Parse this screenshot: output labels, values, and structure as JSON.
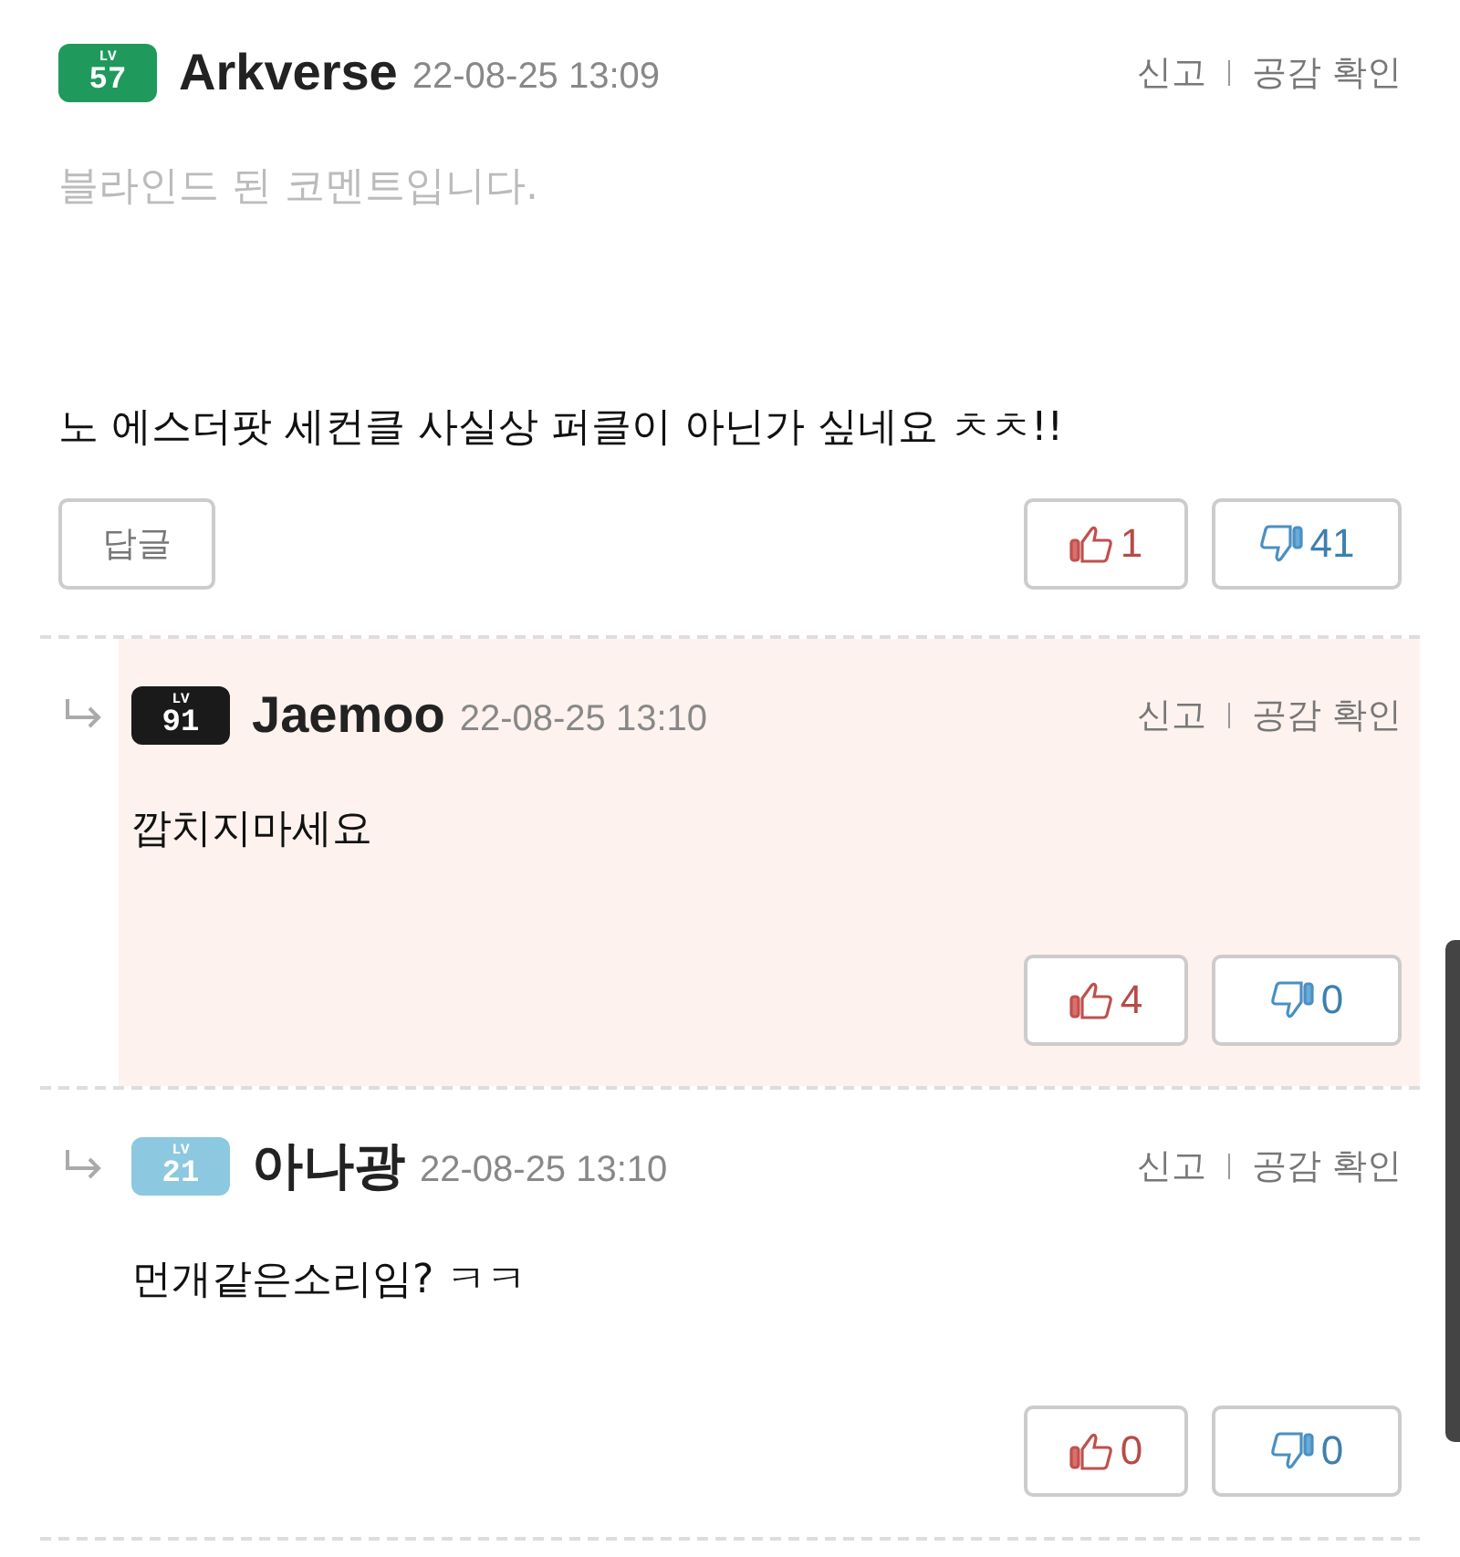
{
  "comments": [
    {
      "kind": "main",
      "highlighted": false,
      "badge": {
        "label": "LV",
        "level": "57",
        "color": "#1f9a5c"
      },
      "author": "Arkverse",
      "date": "22-08-25 13:09",
      "actions": [
        "신고",
        "공감 확인"
      ],
      "blinded_notice": "블라인드 된 코멘트입니다.",
      "text": "노 에스더팟 세컨클 사실상 퍼클이 아닌가 싶네요 ㅊㅊ!!",
      "reply_button": "답글",
      "likes": "1",
      "dislikes": "41"
    },
    {
      "kind": "reply",
      "highlighted": true,
      "badge": {
        "label": "LV",
        "level": "91",
        "color": "#1a1a1a"
      },
      "author": "Jaemoo",
      "date": "22-08-25 13:10",
      "actions": [
        "신고",
        "공감 확인"
      ],
      "text": "깝치지마세요",
      "likes": "4",
      "dislikes": "0"
    },
    {
      "kind": "reply",
      "highlighted": false,
      "badge": {
        "label": "LV",
        "level": "21",
        "color": "#8cc8e0"
      },
      "author": "아나광",
      "date": "22-08-25 13:10",
      "actions": [
        "신고",
        "공감 확인"
      ],
      "text": "먼개같은소리임? ㅋㅋ",
      "likes": "0",
      "dislikes": "0"
    }
  ]
}
